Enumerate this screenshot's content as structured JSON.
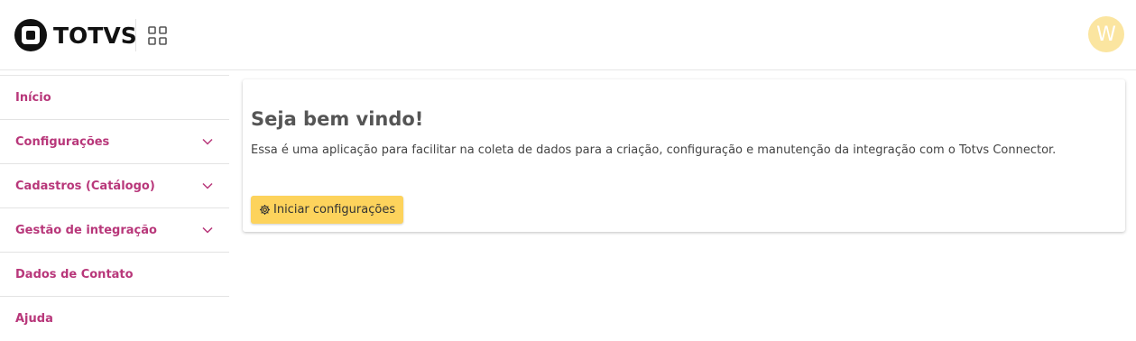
{
  "header": {
    "brand": "TOTVS",
    "apps_icon": "apps-grid-icon",
    "avatar_initial": "W",
    "avatar_color": "#fbe5a0"
  },
  "sidebar": {
    "items": [
      {
        "label": "Início",
        "expandable": false
      },
      {
        "label": "Configurações",
        "expandable": true
      },
      {
        "label": "Cadastros (Catálogo)",
        "expandable": true
      },
      {
        "label": "Gestão de integração",
        "expandable": true
      },
      {
        "label": "Dados de Contato",
        "expandable": false
      },
      {
        "label": "Ajuda",
        "expandable": false
      }
    ],
    "label_color": "#b8377a"
  },
  "main": {
    "title": "Seja bem vindo!",
    "description": "Essa é uma aplicação para facilitar na coleta de dados para a criação, configuração e manutenção da integração com o Totvs Connector.",
    "start_button": {
      "label": "Iniciar configurações",
      "icon": "gear-icon",
      "color": "#fdd35c"
    }
  }
}
